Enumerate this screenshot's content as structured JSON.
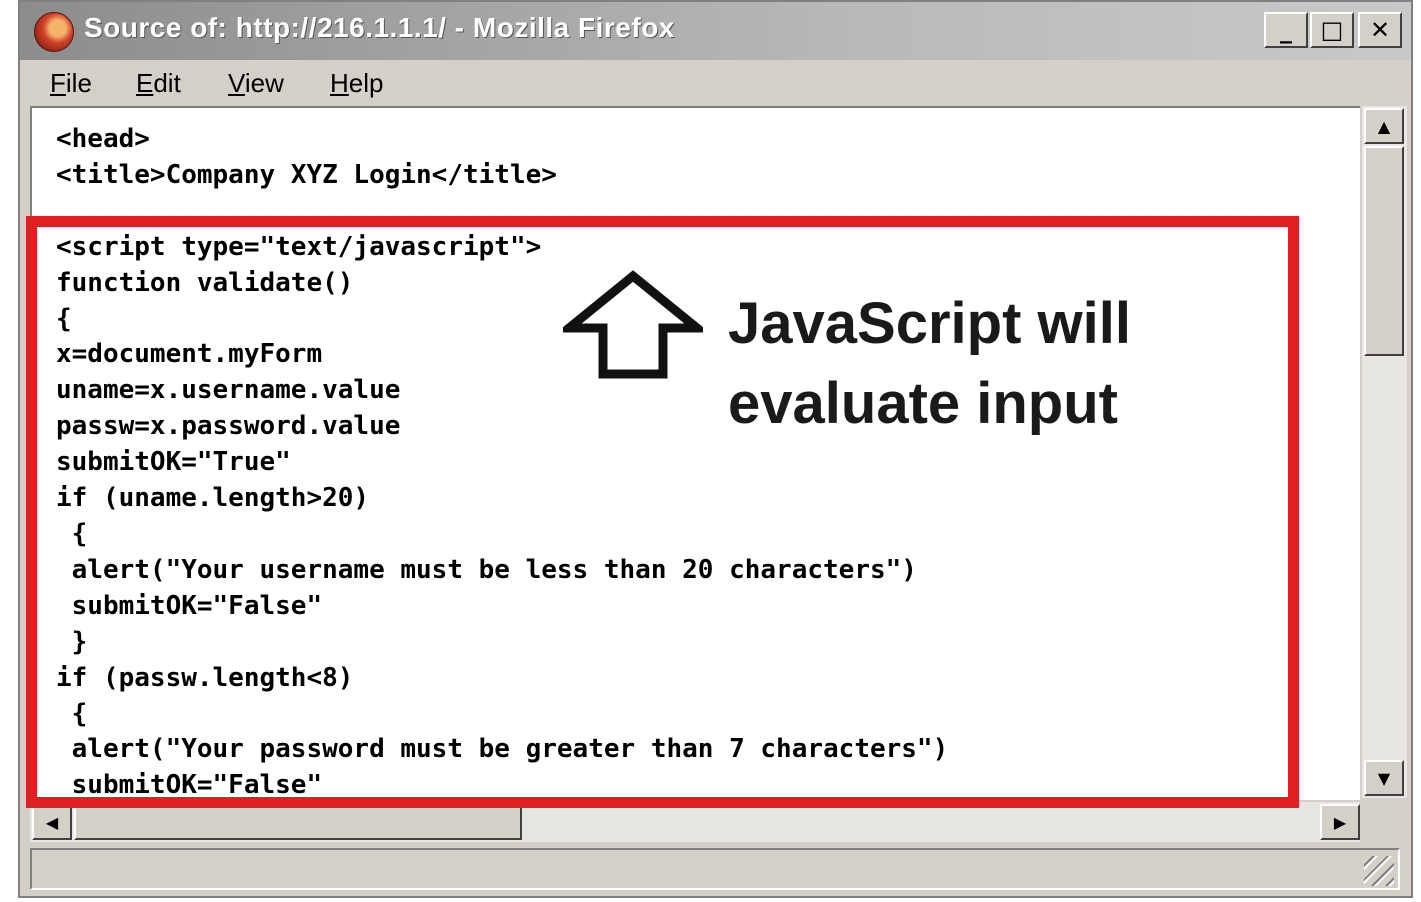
{
  "window": {
    "title": "Source of: http://216.1.1.1/ - Mozilla Firefox",
    "minimize_glyph": "_",
    "maximize_glyph": "□",
    "close_glyph": "✕"
  },
  "menu": {
    "file": {
      "first": "F",
      "rest": "ile"
    },
    "edit": {
      "first": "E",
      "rest": "dit"
    },
    "view": {
      "first": "V",
      "rest": "iew"
    },
    "help": {
      "first": "H",
      "rest": "elp"
    }
  },
  "source": {
    "lines": [
      "<head>",
      "<title>Company XYZ Login</title>",
      "",
      "<script type=\"text/javascript\">",
      "function validate()",
      "{",
      "x=document.myForm",
      "uname=x.username.value",
      "passw=x.password.value",
      "submitOK=\"True\"",
      "if (uname.length>20)",
      " {",
      " alert(\"Your username must be less than 20 characters\")",
      " submitOK=\"False\"",
      " }",
      "if (passw.length<8)",
      " {",
      " alert(\"Your password must be greater than 7 characters\")",
      " submitOK=\"False\""
    ]
  },
  "annotation": {
    "line1": "JavaScript will",
    "line2": "evaluate input",
    "icon": "up-arrow-icon"
  },
  "scrollbars": {
    "up_glyph": "▲",
    "down_glyph": "▼",
    "left_glyph": "◀",
    "right_glyph": "▶"
  },
  "colors": {
    "highlight_border": "#e02020",
    "code_text": "#000000"
  }
}
